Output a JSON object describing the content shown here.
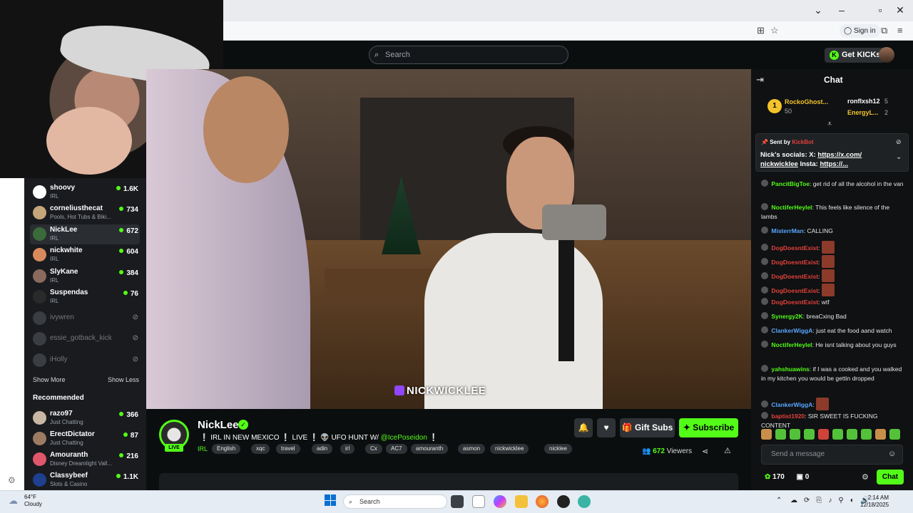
{
  "header": {
    "search_placeholder": "Search",
    "get_kicks": "Get KICKs"
  },
  "browser": {
    "sign_in": "Sign in"
  },
  "sidebar": {
    "following": [
      {
        "name": "shoovy",
        "category": "IRL",
        "viewers": "1.6K",
        "live": true,
        "color": "#ffffff"
      },
      {
        "name": "corneliusthecat",
        "category": "Pools, Hot Tubs & Biki...",
        "viewers": "734",
        "live": true,
        "color": "#c4a67a"
      },
      {
        "name": "NickLee",
        "category": "IRL",
        "viewers": "672",
        "live": true,
        "color": "#3b6b3b"
      },
      {
        "name": "nickwhite",
        "category": "IRL",
        "viewers": "604",
        "live": true,
        "color": "#d98a5c"
      },
      {
        "name": "SlyKane",
        "category": "IRL",
        "viewers": "384",
        "live": true,
        "color": "#8a6a5c"
      },
      {
        "name": "Suspendas",
        "category": "IRL",
        "viewers": "76",
        "live": true,
        "color": "#2a2a2a"
      },
      {
        "name": "ivywren",
        "live": false
      },
      {
        "name": "essie_gotback_kick",
        "live": false
      },
      {
        "name": "iHolly",
        "live": false
      }
    ],
    "show_more": "Show More",
    "show_less": "Show Less",
    "recommended_title": "Recommended",
    "recommended": [
      {
        "name": "razo97",
        "category": "Just Chatting",
        "viewers": "366",
        "color": "#c9b7a5"
      },
      {
        "name": "ErectDictator",
        "category": "Just Chatting",
        "viewers": "87",
        "color": "#9d7b62"
      },
      {
        "name": "Amouranth",
        "category": "Disney Dreamlight Vall...",
        "viewers": "216",
        "color": "#e0566b"
      },
      {
        "name": "Classybeef",
        "category": "Slots & Casino",
        "viewers": "1.1K",
        "color": "#1f3f8f"
      }
    ]
  },
  "video": {
    "watermark": "NICKWICKLEE"
  },
  "stream": {
    "streamer": "NickLee",
    "live_label": "LIVE",
    "title_prefix": "❕ IRL IN NEW MEXICO ❕ LIVE ❕ 👽 UFO HUNT W/ ",
    "title_mention": "@IcePoseidon",
    "title_suffix": " ❕",
    "category": "IRL",
    "tags": [
      "English",
      "xqc",
      "travel",
      "adin",
      "irl",
      "Cx",
      "AC7",
      "amouranth",
      "asmon",
      "nickwicklee",
      "nicklee"
    ],
    "gift_subs": "Gift Subs",
    "subscribe": "Subscribe",
    "viewers": "672",
    "viewers_label": "Viewers"
  },
  "chat": {
    "title": "Chat",
    "leaderboard": [
      {
        "name": "RockoGhost...",
        "value": "50"
      },
      {
        "name": "ronflxsh12",
        "value": "5"
      },
      {
        "name": "EnergyL...",
        "value": "2"
      }
    ],
    "pinned": {
      "sent_by": "Sent by",
      "sender": "KickBot",
      "text_1": "Nick's socials: X: ",
      "link_1": "https://x.com/",
      "link_2": "nickwicklee",
      "text_2": " Insta: ",
      "link_3": "https://..."
    },
    "messages": [
      {
        "user": "PancitBigToe",
        "color": "#53fc18",
        "text": "get rid of all the alcohol in the van"
      },
      {
        "user": "NoctiferHeylel",
        "color": "#53fc18",
        "text": "This feels like silence of the lambs"
      },
      {
        "user": "MisterrMan",
        "color": "#5aa6ff",
        "text": "CALLING"
      },
      {
        "user": "DogDoesntExist",
        "color": "#e3413b",
        "text": ""
      },
      {
        "user": "DogDoesntExist",
        "color": "#e3413b",
        "text": ""
      },
      {
        "user": "DogDoesntExist",
        "color": "#e3413b",
        "text": ""
      },
      {
        "user": "DogDoesntExist",
        "color": "#e3413b",
        "text": ""
      },
      {
        "user": "DogDoesntExist",
        "color": "#e3413b",
        "text": "wtf"
      },
      {
        "user": "Synergy2K",
        "color": "#53fc18",
        "text": "breaCxing Bad"
      },
      {
        "user": "ClankerWiggA",
        "color": "#5aa6ff",
        "text": "just eat the food aand watch"
      },
      {
        "user": "NoctiferHeylel",
        "color": "#53fc18",
        "text": "He isnt talking about you guys"
      },
      {
        "user": "yahshuawins",
        "color": "#53fc18",
        "text": "if I was a cooked and you walked in my kitchen you would be gettin dropped"
      },
      {
        "user": "ClankerWiggA",
        "color": "#5aa6ff",
        "text": ""
      },
      {
        "user": "baptist1920",
        "color": "#e3413b",
        "text": "SIR SWEET IS FUCKING CONTENT"
      }
    ],
    "send_placeholder": "Send a message",
    "kicks": "170",
    "gifts": "0",
    "chat_button": "Chat"
  },
  "taskbar": {
    "temp": "64°F",
    "weather": "Cloudy",
    "search": "Search",
    "time": "2:14 AM",
    "date": "12/18/2025"
  }
}
